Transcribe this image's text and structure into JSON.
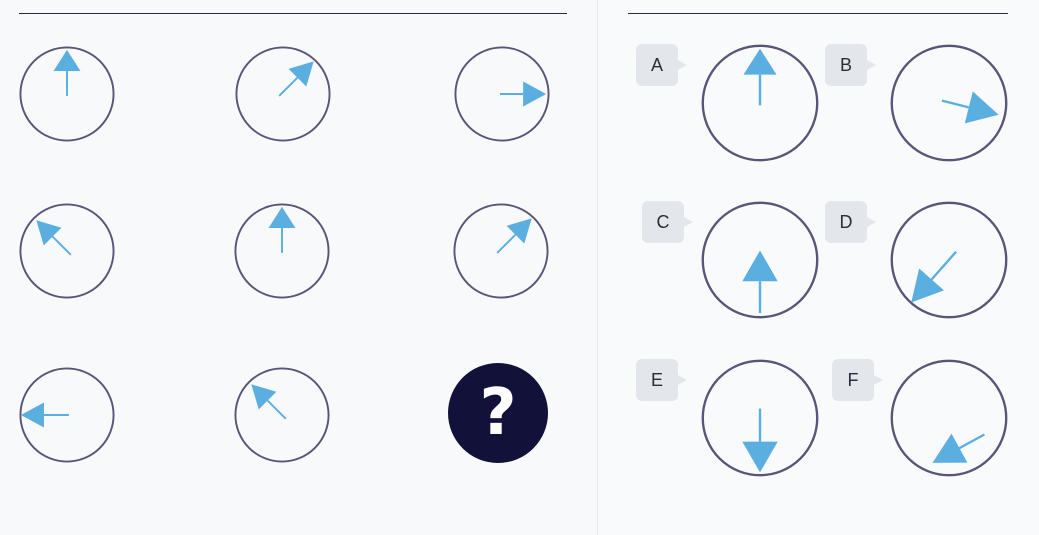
{
  "puzzle": {
    "grid": [
      {
        "arrow": "up"
      },
      {
        "arrow": "up-right"
      },
      {
        "arrow": "right"
      },
      {
        "arrow": "up-left"
      },
      {
        "arrow": "up"
      },
      {
        "arrow": "up-right"
      },
      {
        "arrow": "left"
      },
      {
        "arrow": "up-left"
      }
    ],
    "missing_symbol": "?"
  },
  "options": [
    {
      "label": "A",
      "arrow": "up"
    },
    {
      "label": "B",
      "arrow": "right-down-slight"
    },
    {
      "label": "C",
      "arrow": "up-low"
    },
    {
      "label": "D",
      "arrow": "down-left"
    },
    {
      "label": "E",
      "arrow": "down"
    },
    {
      "label": "F",
      "arrow": "down-left-shallow"
    }
  ],
  "colors": {
    "circle_stroke": "#5a5478",
    "arrow": "#5aaee0",
    "question_bg": "#11113a"
  }
}
